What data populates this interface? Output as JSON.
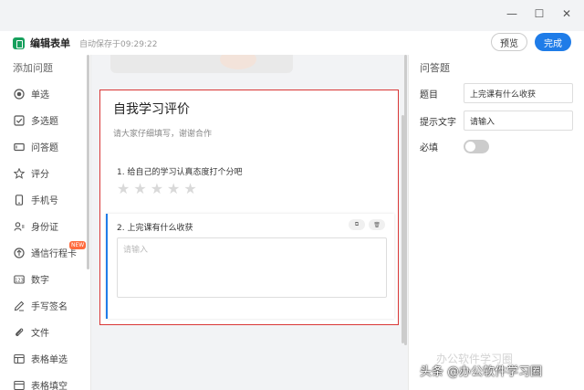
{
  "app": {
    "title": "编辑表单",
    "autosave": "自动保存于09:29:22",
    "preview_label": "预览",
    "done_label": "完成"
  },
  "sidebar": {
    "title": "添加问题",
    "items": [
      {
        "label": "单选",
        "icon": "radio-icon"
      },
      {
        "label": "多选题",
        "icon": "checkbox-icon"
      },
      {
        "label": "问答题",
        "icon": "textbox-icon"
      },
      {
        "label": "评分",
        "icon": "star-icon"
      },
      {
        "label": "手机号",
        "icon": "phone-icon"
      },
      {
        "label": "身份证",
        "icon": "id-card-icon"
      },
      {
        "label": "通信行程卡",
        "icon": "arrow-circle-icon",
        "badge": "NEW"
      },
      {
        "label": "数字",
        "icon": "number-icon"
      },
      {
        "label": "手写签名",
        "icon": "signature-icon"
      },
      {
        "label": "文件",
        "icon": "paperclip-icon"
      },
      {
        "label": "表格单选",
        "icon": "table-icon"
      },
      {
        "label": "表格填空",
        "icon": "table-icon"
      }
    ]
  },
  "form": {
    "title": "自我学习评价",
    "description": "请大家仔细填写，谢谢合作",
    "q1": {
      "title": "1. 给自己的学习认真态度打个分吧",
      "stars": 5
    },
    "q2": {
      "title": "2. 上完课有什么收获",
      "placeholder": "请输入",
      "copy_label": "⧉",
      "delete_label": "🗑"
    }
  },
  "panel": {
    "title": "问答题",
    "title_label": "题目",
    "title_value": "上完课有什么收获",
    "hint_label": "提示文字",
    "hint_value": "请输入",
    "required_label": "必填",
    "required_on": false
  },
  "watermark": {
    "main": "头条 @办公软件学习圈",
    "faint": "办公软件学习圈"
  }
}
